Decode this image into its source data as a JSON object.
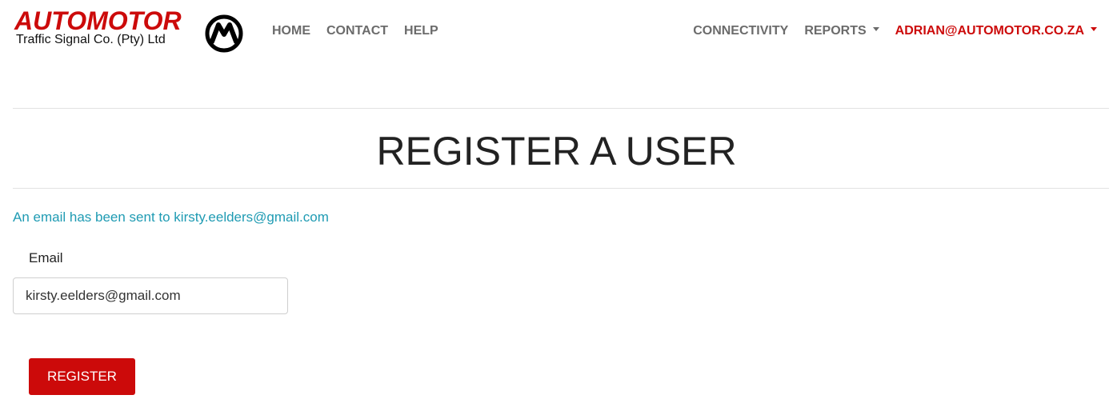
{
  "brand": {
    "name": "AUTOMOTOR",
    "subtitle": "Traffic Signal Co. (Pty) Ltd",
    "emblem_icon": "automotor-emblem-icon",
    "brand_color": "#cc0a0a"
  },
  "nav": {
    "left": [
      {
        "label": "HOME"
      },
      {
        "label": "CONTACT"
      },
      {
        "label": "HELP"
      }
    ],
    "right": {
      "connectivity": "CONNECTIVITY",
      "reports": "REPORTS",
      "user": "ADRIAN@AUTOMOTOR.CO.ZA"
    }
  },
  "page": {
    "title": "REGISTER A USER",
    "alert": "An email has been sent to kirsty.eelders@gmail.com",
    "alert_color": "#1f9bb3"
  },
  "form": {
    "email_label": "Email",
    "email_value": "kirsty.eelders@gmail.com",
    "submit_label": "REGISTER",
    "submit_color": "#cc0a0a"
  }
}
